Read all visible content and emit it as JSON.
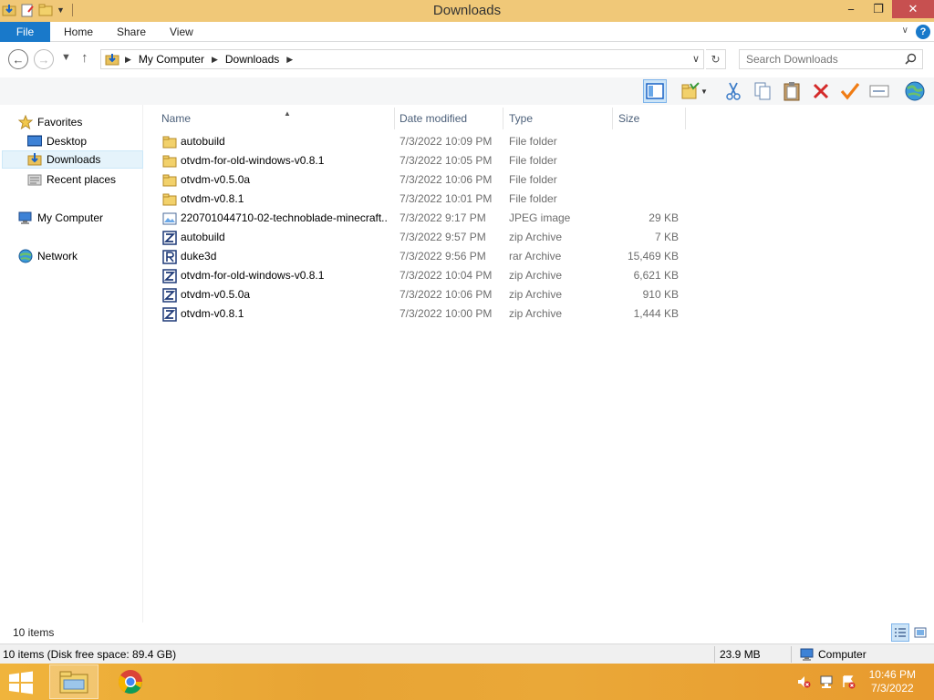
{
  "window": {
    "title": "Downloads",
    "minimize_glyph": "−",
    "restore_glyph": "❐",
    "close_glyph": "✕"
  },
  "ribbon": {
    "tabs": [
      {
        "label": "File"
      },
      {
        "label": "Home"
      },
      {
        "label": "Share"
      },
      {
        "label": "View"
      }
    ],
    "help_glyph": "?"
  },
  "address_bar": {
    "crumbs": [
      "My Computer",
      "Downloads"
    ],
    "search_placeholder": "Search Downloads"
  },
  "toolbar": {
    "icons": [
      "preview-pane-icon",
      "new-folder-icon",
      "cut-icon",
      "copy-icon",
      "paste-icon",
      "delete-icon",
      "check-icon",
      "rename-icon",
      "globe-icon"
    ]
  },
  "nav_pane": {
    "favorites_label": "Favorites",
    "favorites": [
      {
        "label": "Desktop",
        "icon": "desktop-icon"
      },
      {
        "label": "Downloads",
        "icon": "downloads-folder-icon",
        "selected": true
      },
      {
        "label": "Recent places",
        "icon": "recent-places-icon"
      }
    ],
    "computer_label": "My Computer",
    "network_label": "Network"
  },
  "file_list": {
    "columns": [
      "Name",
      "Date modified",
      "Type",
      "Size"
    ],
    "rows": [
      {
        "name": "autobuild",
        "date": "7/3/2022 10:09 PM",
        "type": "File folder",
        "size": "",
        "icon": "folder-icon"
      },
      {
        "name": "otvdm-for-old-windows-v0.8.1",
        "date": "7/3/2022 10:05 PM",
        "type": "File folder",
        "size": "",
        "icon": "folder-icon"
      },
      {
        "name": "otvdm-v0.5.0a",
        "date": "7/3/2022 10:06 PM",
        "type": "File folder",
        "size": "",
        "icon": "folder-icon"
      },
      {
        "name": "otvdm-v0.8.1",
        "date": "7/3/2022 10:01 PM",
        "type": "File folder",
        "size": "",
        "icon": "folder-icon"
      },
      {
        "name": "220701044710-02-technoblade-minecraft...",
        "date": "7/3/2022 9:17 PM",
        "type": "JPEG image",
        "size": "29 KB",
        "icon": "image-icon"
      },
      {
        "name": "autobuild",
        "date": "7/3/2022 9:57 PM",
        "type": "zip Archive",
        "size": "7 KB",
        "icon": "zip-archive-icon"
      },
      {
        "name": "duke3d",
        "date": "7/3/2022 9:56 PM",
        "type": "rar Archive",
        "size": "15,469 KB",
        "icon": "rar-archive-icon"
      },
      {
        "name": "otvdm-for-old-windows-v0.8.1",
        "date": "7/3/2022 10:04 PM",
        "type": "zip Archive",
        "size": "6,621 KB",
        "icon": "zip-archive-icon"
      },
      {
        "name": "otvdm-v0.5.0a",
        "date": "7/3/2022 10:06 PM",
        "type": "zip Archive",
        "size": "910 KB",
        "icon": "zip-archive-icon"
      },
      {
        "name": "otvdm-v0.8.1",
        "date": "7/3/2022 10:00 PM",
        "type": "zip Archive",
        "size": "1,444 KB",
        "icon": "zip-archive-icon"
      }
    ]
  },
  "status": {
    "item_count": "10 items",
    "disk_info": "10 items (Disk free space: 89.4 GB)",
    "size_total": "23.9 MB",
    "location": "Computer"
  },
  "taskbar": {
    "time": "10:46 PM",
    "date": "7/3/2022"
  },
  "colors": {
    "title_bar": "#f0c878",
    "file_tab": "#1979ca",
    "taskbar": "#eaa838",
    "selection": "#e5f3fb"
  }
}
